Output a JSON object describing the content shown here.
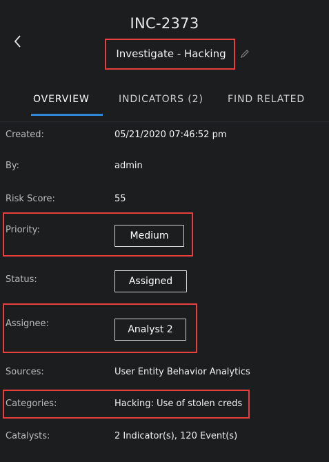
{
  "header": {
    "incident_id": "INC-2373",
    "title": "Investigate - Hacking",
    "back_icon": "chevron-left-icon",
    "edit_icon": "pencil-icon"
  },
  "tabs": [
    {
      "label": "OVERVIEW",
      "active": true
    },
    {
      "label": "INDICATORS (2)",
      "active": false
    },
    {
      "label": "FIND RELATED",
      "active": false
    }
  ],
  "details": {
    "created": {
      "label": "Created:",
      "value": "05/21/2020 07:46:52 pm"
    },
    "by": {
      "label": "By:",
      "value": "admin"
    },
    "risk_score": {
      "label": "Risk Score:",
      "value": "55"
    },
    "priority": {
      "label": "Priority:",
      "value": "Medium"
    },
    "status": {
      "label": "Status:",
      "value": "Assigned"
    },
    "assignee": {
      "label": "Assignee:",
      "value": "Analyst 2"
    },
    "sources": {
      "label": "Sources:",
      "value": "User Entity Behavior Analytics"
    },
    "categories": {
      "label": "Categories:",
      "value": "Hacking:  Use of stolen creds"
    },
    "catalysts": {
      "label": "Catalysts:",
      "value": "2 Indicator(s), 120 Event(s)"
    }
  },
  "colors": {
    "background": "#1c1d1f",
    "accent_underline": "#2f86d4",
    "highlight_border": "#e8403f"
  }
}
